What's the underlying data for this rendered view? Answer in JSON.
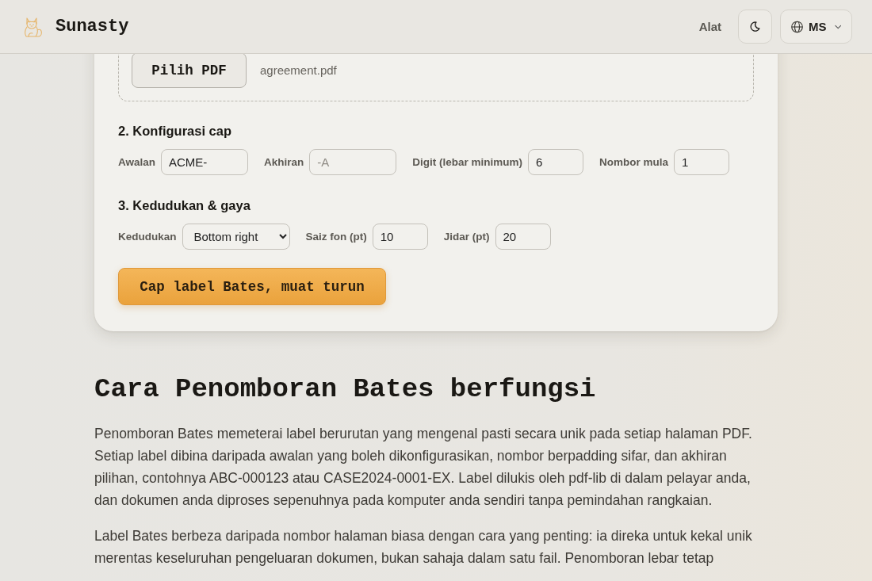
{
  "header": {
    "brand": "Sunasty",
    "nav_link": "Alat",
    "language": "MS"
  },
  "upload": {
    "button": "Pilih PDF",
    "file_name": "agreement.pdf"
  },
  "sections": [
    {
      "title": "2. Konfigurasi cap",
      "fields": [
        {
          "kind": "text",
          "label": "Awalan",
          "value": "ACME-"
        },
        {
          "kind": "text",
          "label": "Akhiran",
          "placeholder": "-A"
        },
        {
          "kind": "number",
          "label": "Digit (lebar minimum)",
          "value": "6"
        },
        {
          "kind": "number",
          "label": "Nombor mula",
          "value": "1"
        }
      ]
    },
    {
      "title": "3. Kedudukan & gaya",
      "fields": [
        {
          "kind": "select",
          "label": "Kedudukan",
          "value": "Bottom right"
        },
        {
          "kind": "number",
          "label": "Saiz fon (pt)",
          "value": "10"
        },
        {
          "kind": "number",
          "label": "Jidar (pt)",
          "value": "20"
        }
      ]
    }
  ],
  "submit_button": "Cap label Bates, muat turun",
  "article": {
    "heading": "Cara Penomboran Bates berfungsi",
    "paragraphs": [
      "Penomboran Bates memeterai label berurutan yang mengenal pasti secara unik pada setiap halaman PDF. Setiap label dibina daripada awalan yang boleh dikonfigurasikan, nombor berpadding sifar, dan akhiran pilihan, contohnya ABC-000123 atau CASE2024-0001-EX. Label dilukis oleh pdf-lib di dalam pelayar anda, dan dokumen anda diproses sepenuhnya pada komputer anda sendiri tanpa pemindahan rangkaian.",
      "Label Bates berbeza daripada nombor halaman biasa dengan cara yang penting: ia direka untuk kekal unik merentas keseluruhan pengeluaran dokumen, bukan sahaja dalam satu fail. Penomboran lebar tetap"
    ]
  }
}
